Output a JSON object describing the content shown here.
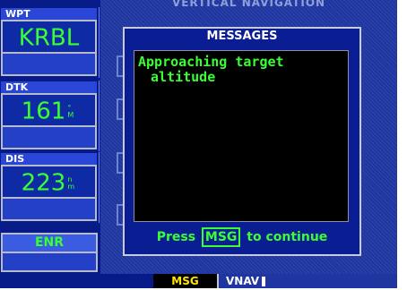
{
  "page": {
    "title": "VERTICAL NAVIGATION"
  },
  "fields": [
    {
      "label": "WPT",
      "value": "KRBL",
      "unit_top": "",
      "unit_bottom": ""
    },
    {
      "label": "DTK",
      "value": "161",
      "unit_top": "°",
      "unit_bottom": "M"
    },
    {
      "label": "DIS",
      "value": "223",
      "unit_top": "n",
      "unit_bottom": "m"
    }
  ],
  "mode": {
    "label": "ENR"
  },
  "dialog": {
    "title": "MESSAGES",
    "message_line1": "Approaching target",
    "message_line2": "altitude",
    "footer_before": "Press",
    "footer_key": "MSG",
    "footer_after": "to continue"
  },
  "status": {
    "msg": "MSG",
    "vnav": "VNAV"
  },
  "colors": {
    "accent_green": "#39ff32",
    "status_yellow": "#ffe600",
    "panel_blue": "#071b88"
  }
}
